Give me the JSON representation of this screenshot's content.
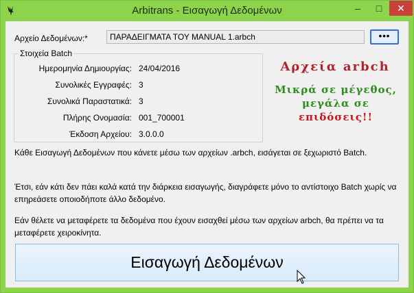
{
  "window": {
    "title": "Arbitrans - Εισαγωγή Δεδομένων",
    "controls": {
      "minimize": "–",
      "maximize": "□",
      "close": "✕"
    }
  },
  "file": {
    "label": "Αρχείο Δεδομένων:*",
    "value": "ΠΑΡΑΔΕΙΓΜΑΤΑ ΤΟΥ MANUAL 1.arbch",
    "browse_label": "•••"
  },
  "batch": {
    "title": "Στοιχεία Batch",
    "rows": [
      {
        "label": "Ημερομηνία Δημιουργίας:",
        "value": "24/04/2016"
      },
      {
        "label": "Συνολικές Εγγραφές:",
        "value": "3"
      },
      {
        "label": "Συνολικά Παραστατικά:",
        "value": "3"
      },
      {
        "label": "Πλήρης Ονομασία:",
        "value": "001_700001"
      },
      {
        "label": "Έκδοση Αρχείου:",
        "value": "3.0.0.0"
      }
    ]
  },
  "promo": {
    "title": "Αρχεία arbch",
    "line1": "Μικρά σε μέγεθος,",
    "line2": "μεγάλα σε",
    "line3": "επιδόσεις!!"
  },
  "info": {
    "p1": "Κάθε Εισαγωγή Δεδομένων που κάνετε μέσω των αρχείων .arbch, εισάγεται σε ξεχωριστό Batch.",
    "p2": "Έτσι, εάν κάτι δεν πάει καλά κατά την διάρκεια εισαγωγής, διαγράφετε μόνο το αντίστοιχο Batch χωρίς να επηρεάσετε οποιοδήποτε άλλο δεδομένο.",
    "p3": "Εάν θέλετε να μεταφέρετε τα δεδομένα που έχουν εισαχθεί μέσω των αρχείων arbch, θα πρέπει να τα μεταφέρετε χειροκίνητα."
  },
  "import_button": {
    "label": "Εισαγωγή Δεδομένων"
  },
  "colors": {
    "titlebar": "#8cd44c",
    "promo_red": "#b0232a",
    "promo_green": "#2e8b1e"
  },
  "icons": {
    "app": "eagle-icon",
    "cursor": "mouse-pointer-icon"
  }
}
